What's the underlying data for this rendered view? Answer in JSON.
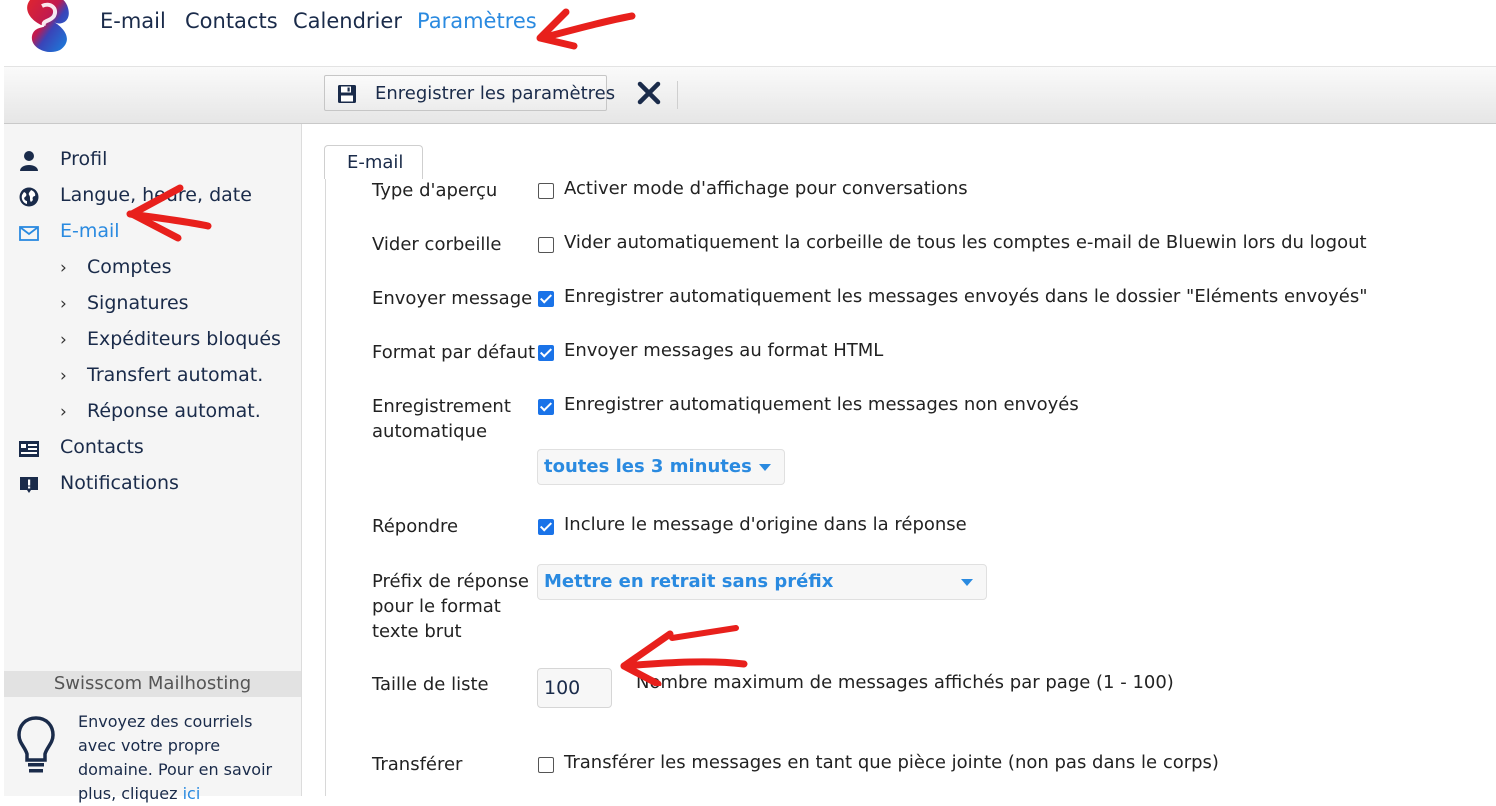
{
  "brand": {
    "logo": "swisscom-logo"
  },
  "topnav": {
    "items": [
      {
        "label": "E-mail",
        "active": false
      },
      {
        "label": "Contacts",
        "active": false
      },
      {
        "label": "Calendrier",
        "active": false
      },
      {
        "label": "Paramètres",
        "active": true
      }
    ]
  },
  "toolbar": {
    "save_label": "Enregistrer les paramètres",
    "save_icon": "floppy-disk-icon",
    "close_icon": "close-icon"
  },
  "sidebar": {
    "items": [
      {
        "label": "Profil",
        "icon": "user-icon"
      },
      {
        "label": "Langue, heure, date",
        "icon": "globe-icon"
      },
      {
        "label": "E-mail",
        "icon": "envelope-icon",
        "active": true
      },
      {
        "label": "Contacts",
        "icon": "contact-card-icon"
      },
      {
        "label": "Notifications",
        "icon": "notification-icon"
      }
    ],
    "subitems": [
      {
        "label": "Comptes"
      },
      {
        "label": "Signatures"
      },
      {
        "label": "Expéditeurs bloqués"
      },
      {
        "label": "Transfert automat."
      },
      {
        "label": "Réponse automat."
      }
    ],
    "promo": {
      "title": "Swisscom Mailhosting",
      "text": "Envoyez des courriels avec votre propre domaine. Pour en savoir plus, cliquez",
      "link": "ici"
    }
  },
  "content": {
    "tab": "E-mail",
    "rows": {
      "preview_type": {
        "label": "Type d'aperçu",
        "checkbox": "Activer mode d'affichage pour conversations",
        "checked": false
      },
      "empty_trash": {
        "label": "Vider corbeille",
        "checkbox": "Vider automatiquement la corbeille de tous les comptes e-mail de Bluewin lors du logout",
        "checked": false
      },
      "send_message": {
        "label": "Envoyer message",
        "checkbox": "Enregistrer automatiquement les messages envoyés dans le dossier \"Eléments envoyés\"",
        "checked": true
      },
      "default_format": {
        "label": "Format par défaut",
        "checkbox": "Envoyer messages au format HTML",
        "checked": true
      },
      "autosave": {
        "label_line1": "Enregistrement",
        "label_line2": "automatique",
        "checkbox": "Enregistrer automatiquement les messages non envoyés",
        "checked": true,
        "interval": "toutes les 3 minutes"
      },
      "reply": {
        "label": "Répondre",
        "checkbox": "Inclure le message d'origine dans la réponse",
        "checked": true
      },
      "reply_prefix": {
        "label_line1": "Préfix de réponse",
        "label_line2": "pour le format",
        "label_line3": "texte brut",
        "value": "Mettre en retrait sans préfix"
      },
      "list_size": {
        "label": "Taille de liste",
        "value": "100",
        "hint": "Nombre maximum de messages affichés par page (1 - 100)"
      },
      "forward": {
        "label": "Transférer",
        "checkbox": "Transférer les messages en tant que pièce jointe (non pas dans le corps)",
        "checked": false
      }
    }
  },
  "colors": {
    "accent": "#2a8ae0",
    "nav_text": "#1a2b4a",
    "checkbox_on": "#1a73e8",
    "annotation": "#e8201c"
  }
}
